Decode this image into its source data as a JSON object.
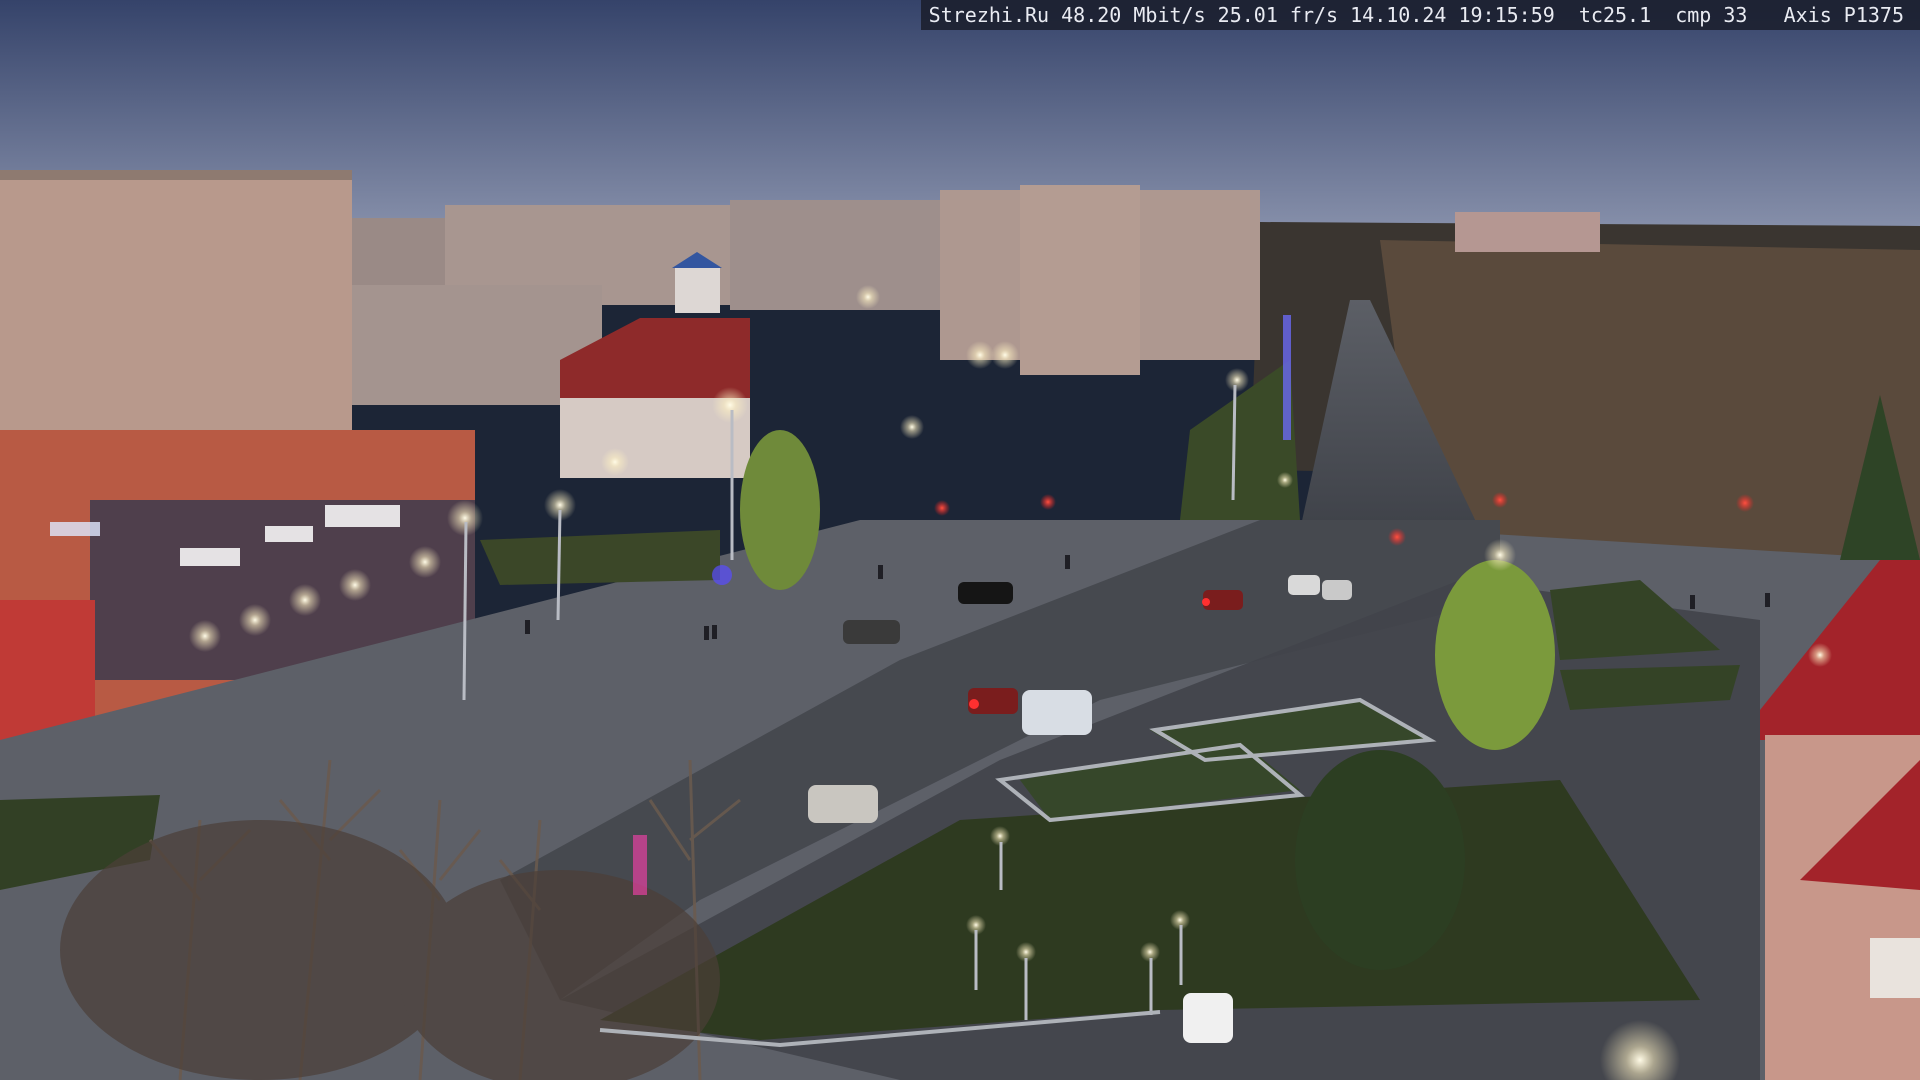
{
  "overlay": {
    "text": "Strezhi.Ru 48.20 Mbit/s 25.01 fr/s 14.10.24 19:15:59  tc25.1  cmp 33   Axis P1375"
  },
  "colors": {
    "sky_top": "#3b4a6e",
    "sky_bottom": "#7b86a5",
    "road": "#4a4d55",
    "grass": "#2f3b24",
    "building_panel": "#b79a8c",
    "building_red": "#a8342f",
    "lamp_glow": "#fff6d8",
    "tail_light": "#ff2a2a"
  }
}
